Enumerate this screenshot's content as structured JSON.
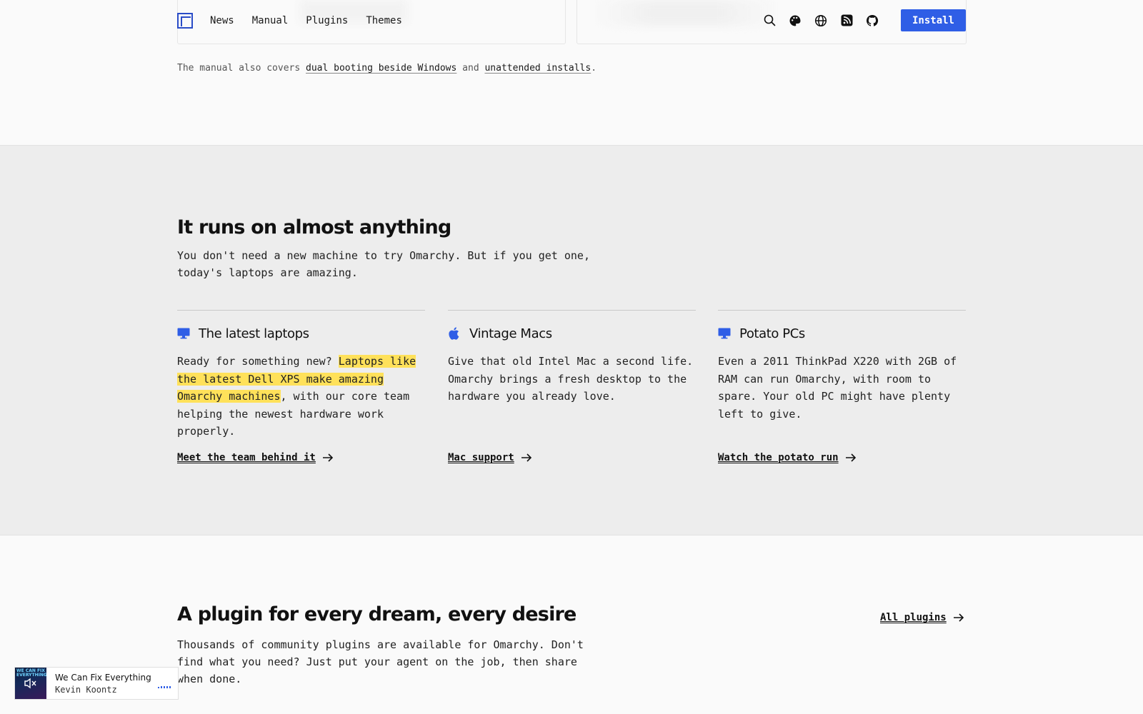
{
  "nav": {
    "links": [
      "News",
      "Manual",
      "Plugins",
      "Themes"
    ],
    "icons": [
      "search-icon",
      "palette-icon",
      "globe-icon",
      "rss-icon",
      "github-icon"
    ],
    "install_label": "Install",
    "accent": "#2f5ee6"
  },
  "manual_note": {
    "prefix": "The manual also covers ",
    "link1": "dual booting beside Windows",
    "middle": " and ",
    "link2": "unattended installs",
    "suffix": "."
  },
  "runs": {
    "title": "It runs on almost anything",
    "subtitle_line1": "You don't need a new machine to try Omarchy. But if you get one,",
    "subtitle_line2": "today's laptops are amazing.",
    "columns": [
      {
        "icon": "monitor-icon",
        "title": "The latest laptops",
        "body_pre": "Ready for something new? ",
        "body_highlight": "Laptops like the latest Dell XPS make amazing Omarchy machines",
        "body_post": ", with our core team helping the newest hardware work properly.",
        "link": "Meet the team behind it"
      },
      {
        "icon": "apple-icon",
        "title": "Vintage Macs",
        "body": "Give that old Intel Mac a second life. Omarchy brings a fresh desktop to the hardware you already love.",
        "link": "Mac support"
      },
      {
        "icon": "monitor-icon",
        "title": "Potato PCs",
        "body": "Even a 2011 ThinkPad X220 with 2GB of RAM can run Omarchy, with room to spare. Your old PC might have plenty left to give.",
        "link": "Watch the potato run"
      }
    ]
  },
  "plugins": {
    "title": "A plugin for every dream, every desire",
    "subtitle_line1": "Thousands of community plugins are available for Omarchy. Don't",
    "subtitle_line2": "find what you need? Just put your agent on the job, then share",
    "subtitle_line3": "when done.",
    "all_label": "All plugins"
  },
  "player": {
    "cover_text": "WE CAN FIX EVERYTHING",
    "track": "We Can Fix Everything",
    "artist": "Kevin Koontz"
  }
}
